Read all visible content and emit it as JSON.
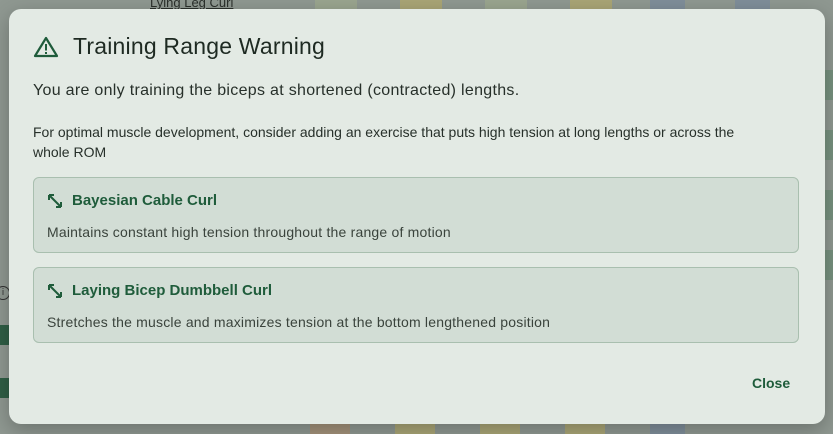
{
  "background": {
    "partial_title": "Lying Leg Curl"
  },
  "dialog": {
    "title": "Training Range Warning",
    "message": "You are only training the biceps at shortened (contracted) lengths.",
    "advice": "For optimal muscle development, consider adding an exercise that puts high tension at long lengths or across the whole ROM",
    "suggestions": [
      {
        "name": "Bayesian Cable Curl",
        "description": "Maintains constant high tension throughout the range of motion",
        "icon": "expand-diagonal-icon"
      },
      {
        "name": "Laying Bicep Dumbbell Curl",
        "description": "Stretches the muscle and maximizes tension at the bottom lengthened position",
        "icon": "expand-diagonal-icon"
      }
    ],
    "close_label": "Close",
    "icon": "warning-icon"
  },
  "colors": {
    "dialog_bg": "#e3eae4",
    "card_bg": "#d2ddd5",
    "card_border": "#a9bfaf",
    "accent": "#1f5c3b",
    "text": "#27302a"
  }
}
